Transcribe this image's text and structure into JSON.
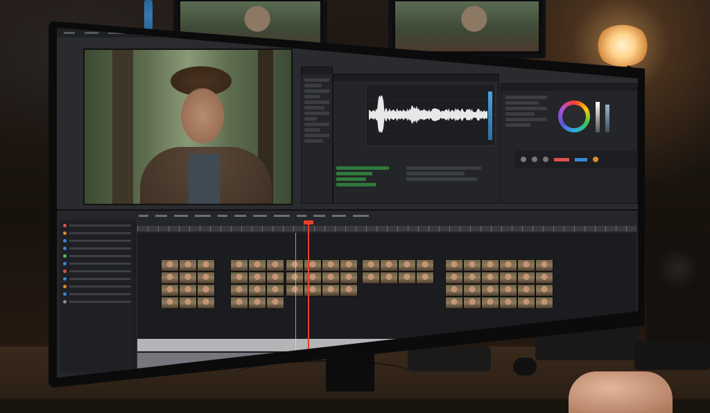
{
  "scene": {
    "description_tags": [
      "video-editing-workstation",
      "ultrawide-monitor",
      "desk-lamp",
      "speaker"
    ],
    "colors": {
      "playhead": "#e4412c",
      "ui_background": "#2a2b2e",
      "lamp_glow": "#ffd28a"
    }
  },
  "editor": {
    "menu_items": [
      "",
      "",
      "",
      "",
      "",
      "",
      "",
      ""
    ],
    "timeline_tabs": [
      "",
      "",
      "",
      "",
      "",
      "",
      "",
      "",
      "",
      "",
      "",
      ""
    ],
    "side_rows": [
      {
        "color": "#d9534f"
      },
      {
        "color": "#e08a2e"
      },
      {
        "color": "#3a87d6"
      },
      {
        "color": "#3a87d6"
      },
      {
        "color": "#5fb85f"
      },
      {
        "color": "#3a87d6"
      },
      {
        "color": "#d9534f"
      },
      {
        "color": "#3a87d6"
      },
      {
        "color": "#e08a2e"
      },
      {
        "color": "#3a87d6"
      },
      {
        "color": "#8e8e8e"
      }
    ],
    "clip_groups": [
      {
        "rows": 4,
        "cols": 3
      },
      {
        "rows": 4,
        "cols": 3
      },
      {
        "rows": 3,
        "cols": 4
      },
      {
        "rows": 2,
        "cols": 4
      },
      {
        "rows": 4,
        "cols": 6
      }
    ]
  }
}
